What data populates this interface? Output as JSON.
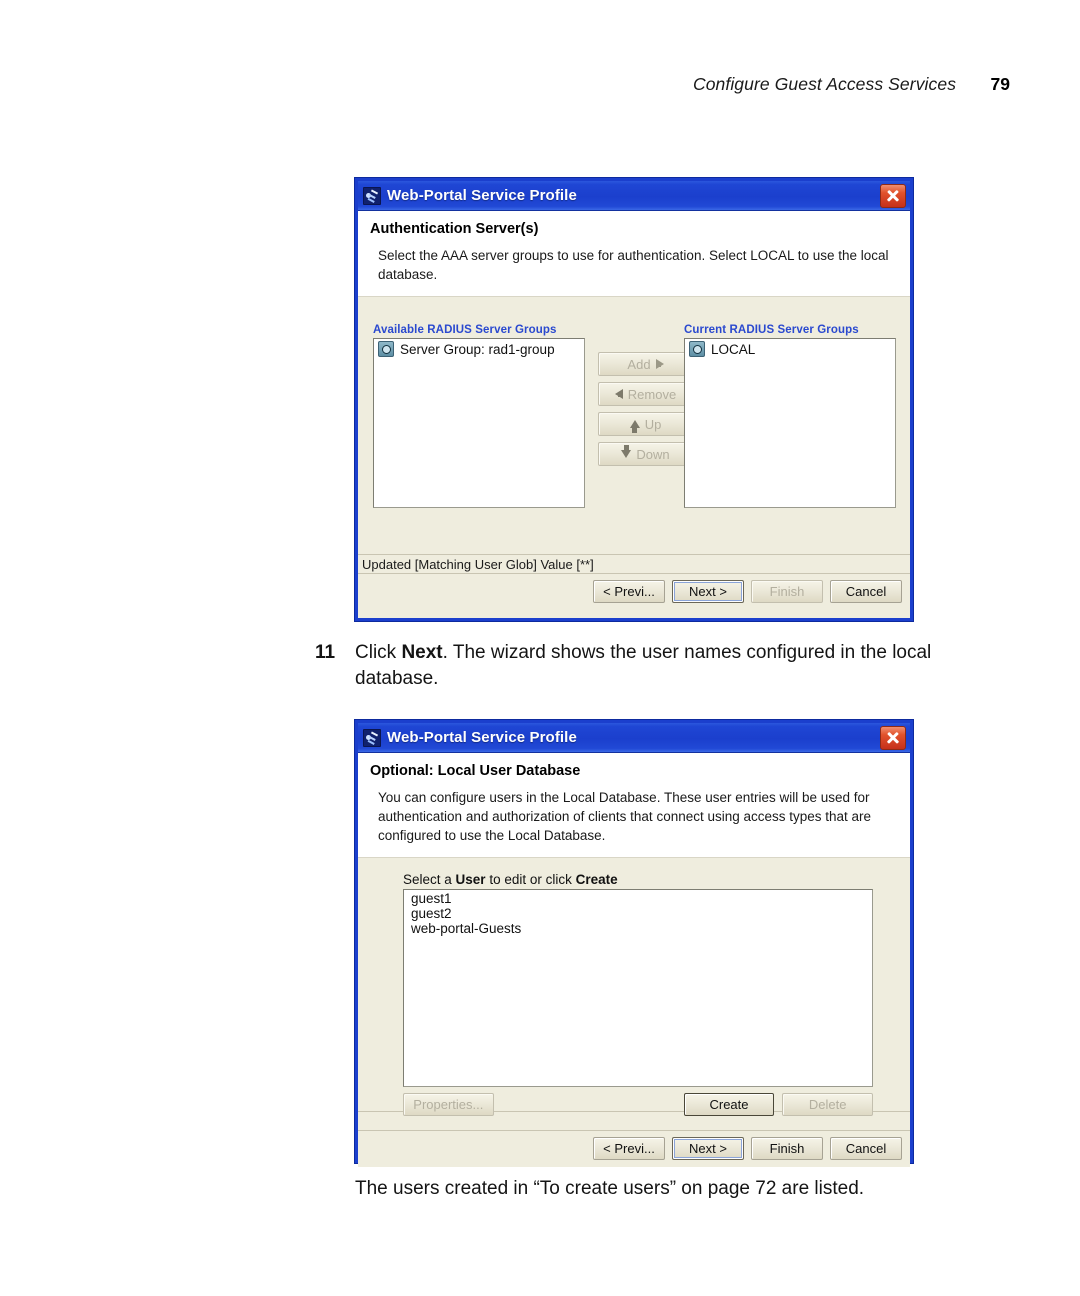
{
  "header": {
    "running_title": "Configure Guest Access Services",
    "page_number": "79"
  },
  "dialog1": {
    "icon": "web-portal-app-icon",
    "title": "Web-Portal Service Profile",
    "close_icon": "close-icon",
    "heading": "Authentication Server(s)",
    "description": "Select the AAA server groups to use for authentication. Select LOCAL to use the local database.",
    "available": {
      "label": "Available RADIUS Server Groups",
      "items": [
        {
          "icon": "server-group-icon",
          "label": "Server Group: rad1-group"
        }
      ]
    },
    "current": {
      "label": "Current RADIUS Server Groups",
      "items": [
        {
          "icon": "server-group-icon",
          "label": "LOCAL"
        }
      ]
    },
    "transfer_buttons": [
      {
        "label": "Add",
        "icon": "arrow-right-icon",
        "enabled": false
      },
      {
        "label": "Remove",
        "icon": "arrow-left-icon",
        "enabled": false
      },
      {
        "label": "Up",
        "icon": "arrow-up-icon",
        "enabled": false
      },
      {
        "label": "Down",
        "icon": "arrow-down-icon",
        "enabled": false
      }
    ],
    "status": "Updated [Matching User Glob] Value [**]",
    "footer": {
      "previous": "< Previ...",
      "next": "Next >",
      "finish": "Finish",
      "cancel": "Cancel"
    }
  },
  "step11": {
    "number": "11",
    "text_before": "Click ",
    "bold": "Next",
    "text_after": ". The wizard shows the user names configured in the local database."
  },
  "dialog2": {
    "icon": "web-portal-app-icon",
    "title": "Web-Portal Service Profile",
    "close_icon": "close-icon",
    "heading": "Optional: Local User Database",
    "description": "You can configure users in the Local Database. These user entries will be used for authentication and authorization of clients that connect using access types that are configured to use the Local Database.",
    "list_label": {
      "pre": "Select a ",
      "bold1": "User",
      "mid": " to edit or click ",
      "bold2": "Create"
    },
    "users": [
      "guest1",
      "guest2",
      "web-portal-Guests"
    ],
    "action_buttons": [
      {
        "label": "Properties...",
        "enabled": false
      },
      {
        "label": "Create",
        "enabled": true
      },
      {
        "label": "Delete",
        "enabled": false
      }
    ],
    "status": "",
    "footer": {
      "previous": "< Previ...",
      "next": "Next >",
      "finish": "Finish",
      "cancel": "Cancel"
    }
  },
  "caption": "The users created in “To create users” on page 72 are listed."
}
